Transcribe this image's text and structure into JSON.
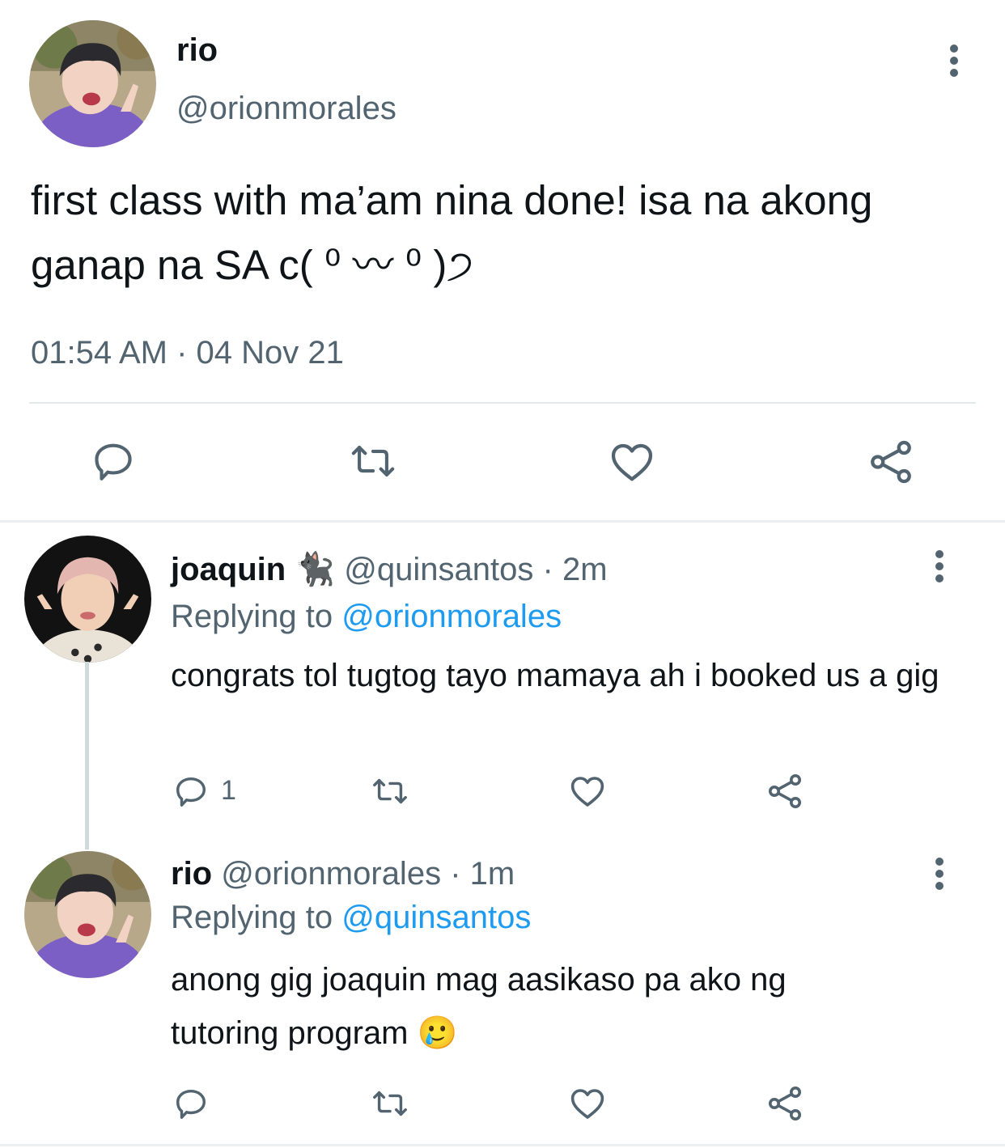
{
  "main_tweet": {
    "name": "rio",
    "handle": "@orionmorales",
    "text": "first class with ma’am nina done! isa na akong ganap na SA c( ⁰ 〰 ⁰ )੭",
    "timestamp": "01:54 AM · 04 Nov 21",
    "avatar_icon": "avatar-photo"
  },
  "replies": [
    {
      "name": "joaquin",
      "name_emoji": "🐈‍⬛",
      "handle": "@quinsantos",
      "sep": "·",
      "time": "2m",
      "replying_label": "Replying to",
      "replying_to": "@orionmorales",
      "text": "congrats tol tugtog tayo mamaya ah i booked us a gig",
      "reply_count": "1"
    },
    {
      "name": "rio",
      "handle": "@orionmorales",
      "sep": "·",
      "time": "1m",
      "replying_label": "Replying to",
      "replying_to": "@quinsantos",
      "text": "anong gig joaquin mag aasikaso pa ako ng tutoring program",
      "text_emoji": "🥲",
      "reply_count": ""
    }
  ],
  "icons": [
    "reply-icon",
    "retweet-icon",
    "like-icon",
    "share-icon",
    "more-icon"
  ],
  "colors": {
    "text": "#0f1419",
    "secondary": "#536471",
    "link": "#1d9bf0",
    "divider": "#e6e9eb"
  }
}
